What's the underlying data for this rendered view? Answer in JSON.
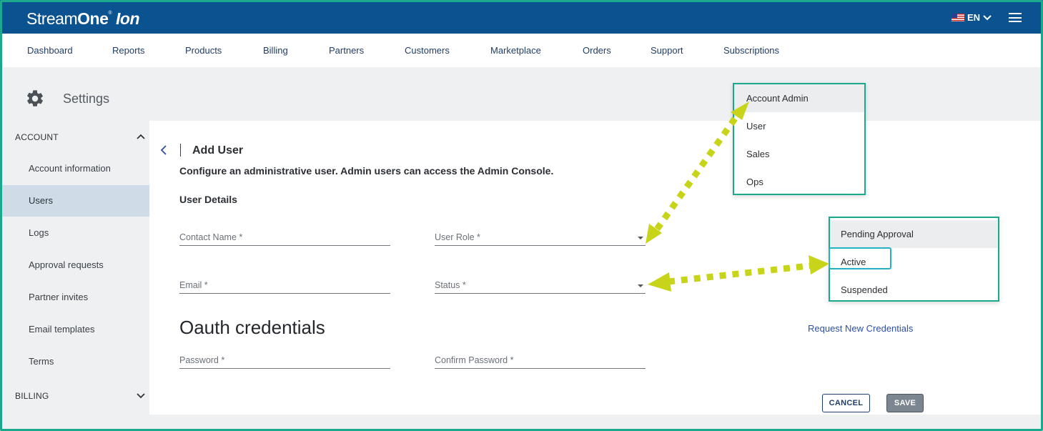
{
  "brand": {
    "name_part1": "Stream",
    "name_part2": "One",
    "reg_mark": "®",
    "name_part3": "Ion"
  },
  "header": {
    "language": "EN"
  },
  "nav": [
    "Dashboard",
    "Reports",
    "Products",
    "Billing",
    "Partners",
    "Customers",
    "Marketplace",
    "Orders",
    "Support",
    "Subscriptions"
  ],
  "settings": {
    "title": "Settings"
  },
  "sidebar": {
    "account_section": "ACCOUNT",
    "items": [
      "Account information",
      "Users",
      "Logs",
      "Approval requests",
      "Partner invites",
      "Email templates",
      "Terms"
    ],
    "active_item": "Users",
    "billing_section": "BILLING"
  },
  "form": {
    "title": "Add User",
    "description": "Configure an administrative user. Admin users can access the Admin Console.",
    "section_title": "User Details",
    "contact_name_placeholder": "Contact Name *",
    "user_role_label": "User Role *",
    "email_placeholder": "Email *",
    "status_label": "Status *",
    "oauth_title": "Oauth credentials",
    "request_link": "Request New Credentials",
    "password_placeholder": "Password *",
    "confirm_password_placeholder": "Confirm Password *",
    "cancel_label": "CANCEL",
    "save_label": "SAVE"
  },
  "role_menu": [
    "Account Admin",
    "User",
    "Sales",
    "Ops"
  ],
  "status_menu": [
    "Pending Approval",
    "Active",
    "Suspended"
  ],
  "colors": {
    "header_blue": "#0b5290",
    "frame_green": "#1aa98c",
    "active_highlight": "#22b3c2",
    "arrow_yellow": "#c8d41a",
    "sidebar_active": "#cfdce8"
  },
  "icons": {
    "settings": "gear-icon",
    "back": "chevron-left-icon",
    "menu": "hamburger-icon",
    "flag": "us-flag-icon",
    "expand": "chevron-up-icon",
    "collapse": "chevron-down-icon"
  }
}
